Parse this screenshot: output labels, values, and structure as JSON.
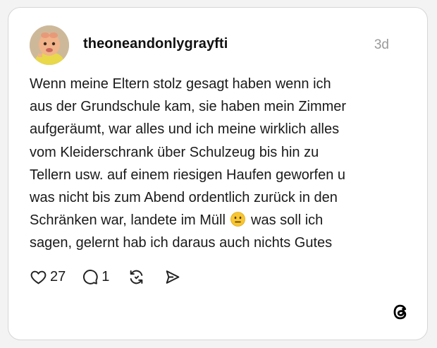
{
  "post": {
    "username": "theoneandonlygrayfti",
    "timestamp": "3d",
    "lines": [
      "Wenn meine Eltern stolz gesagt haben wenn ich",
      "aus der Grundschule kam, sie haben mein Zimmer",
      "aufgeräumt, war alles und ich meine wirklich alles",
      "vom Kleiderschrank über Schulzeug bis hin zu",
      "Tellern usw. auf einem riesigen Haufen geworfen u",
      "was nicht bis zum Abend ordentlich zurück in den"
    ],
    "line7_before": "Schränken war, landete im Müll",
    "line7_emoji": "neutral-face-emoji",
    "line7_after": "was soll ich",
    "line8": "sagen, gelernt hab ich daraus auch nichts Gutes"
  },
  "actions": {
    "like_icon": "heart-icon",
    "like_count": "27",
    "reply_icon": "comment-icon",
    "reply_count": "1",
    "repost_icon": "repost-icon",
    "share_icon": "send-icon"
  },
  "brand": {
    "logo_icon": "threads-logo-icon"
  }
}
